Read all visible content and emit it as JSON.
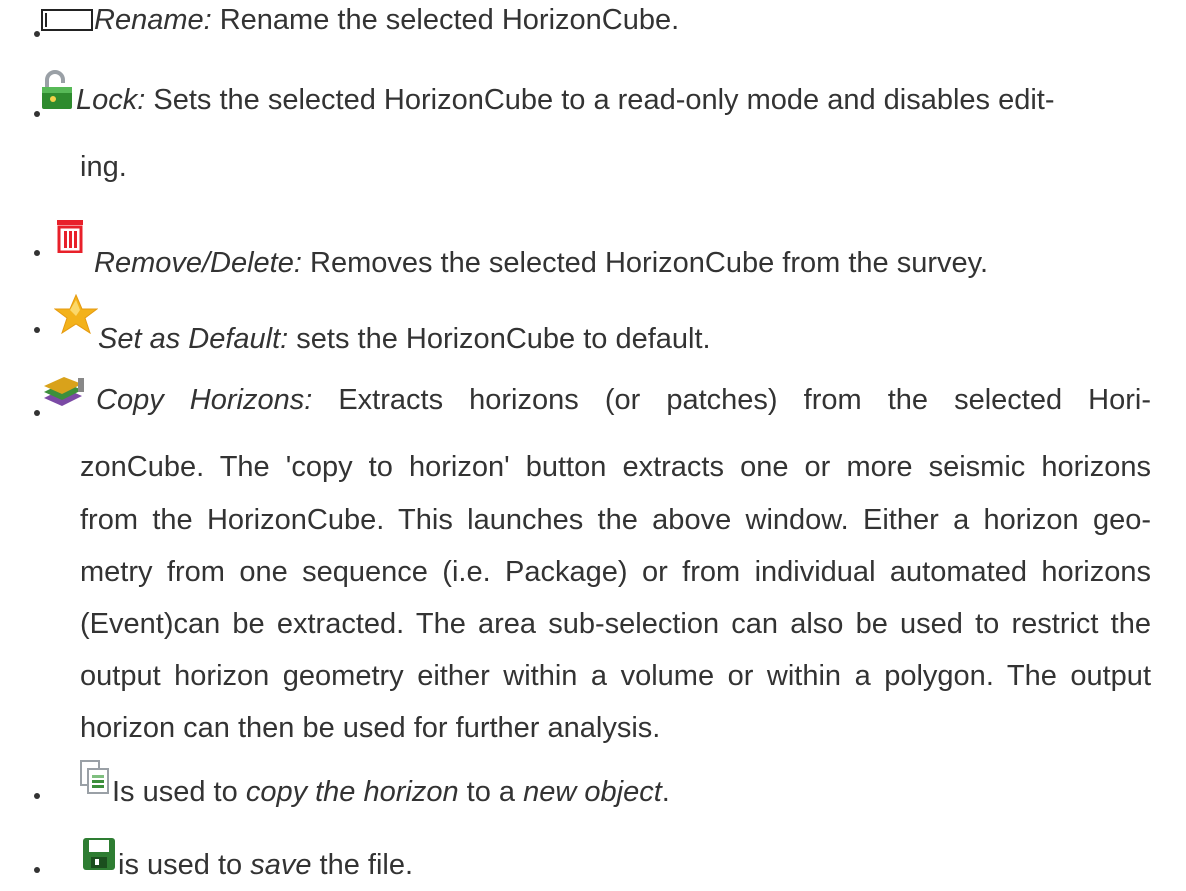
{
  "items": [
    {
      "icon": "rename-icon",
      "term": "Rename:",
      "text": " Rename the selected HorizonCube."
    },
    {
      "icon": "lock-icon",
      "term": "Lock:",
      "text": " Sets the selected HorizonCube to a read-only mode and disables edit-",
      "text2": "ing."
    },
    {
      "icon": "trash-icon",
      "term": "Remove/Delete:",
      "text": " Removes the selected HorizonCube from the survey."
    },
    {
      "icon": "star-icon",
      "term": "Set as Default:",
      "text": " sets the HorizonCube to default."
    },
    {
      "icon": "copy-horizons-icon",
      "term": "Copy Horizons:",
      "line1": " Extracts horizons (or patches) from the selected Hori-",
      "lines": [
        "zonCube. The 'copy to horizon' button extracts one or more seismic horizons",
        "from the HorizonCube. This launches the above window. Either a horizon geo-",
        "metry from one sequence (i.e. Package) or from individual automated horizons",
        "(Event)can be extracted. The area sub-selection can also be used to restrict the",
        "output horizon geometry either within a volume or within a polygon. The output",
        "horizon can then be used for further analysis."
      ]
    },
    {
      "icon": "copy-object-icon",
      "pre": "Is used to ",
      "em1": "copy the horizon",
      "mid": " to a ",
      "em2": "new object",
      "post": "."
    },
    {
      "icon": "save-icon",
      "pre": " is used to ",
      "em1": "save",
      "post": " the file."
    }
  ],
  "colors": {
    "text": "#333333",
    "trash": "#e8202a",
    "lock": "#2e8b2e",
    "star": "#f3b21a",
    "save": "#2e7d32"
  }
}
